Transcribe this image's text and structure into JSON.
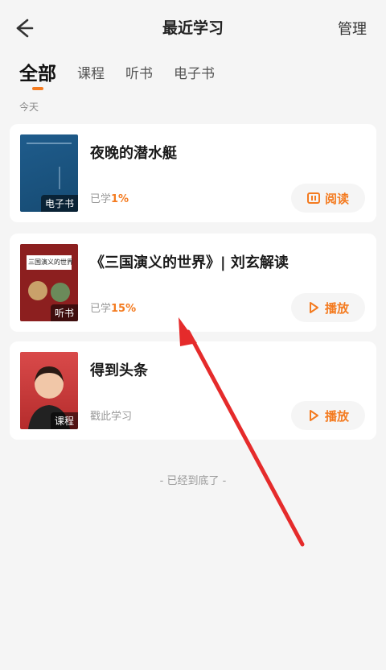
{
  "header": {
    "title": "最近学习",
    "manage_label": "管理"
  },
  "tabs": [
    {
      "label": "全部",
      "active": true
    },
    {
      "label": "课程",
      "active": false
    },
    {
      "label": "听书",
      "active": false
    },
    {
      "label": "电子书",
      "active": false
    }
  ],
  "section_label": "今天",
  "items": [
    {
      "title": "夜晚的潜水艇",
      "badge": "电子书",
      "progress_prefix": "已学",
      "progress_value": "1%",
      "action_label": "阅读",
      "action_icon": "book-open-icon"
    },
    {
      "title": "《三国演义的世界》| 刘玄解读",
      "badge": "听书",
      "progress_prefix": "已学",
      "progress_value": "15%",
      "action_label": "播放",
      "action_icon": "play-icon"
    },
    {
      "title": "得到头条",
      "badge": "课程",
      "progress_prefix": "戳此学习",
      "progress_value": "",
      "action_label": "播放",
      "action_icon": "play-icon"
    }
  ],
  "cover_texts": {
    "audio_cover_line1": "三国演义的世界"
  },
  "footer_note": "- 已经到底了 -",
  "colors": {
    "accent": "#f47b20",
    "annotation_arrow": "#e52b2b"
  }
}
